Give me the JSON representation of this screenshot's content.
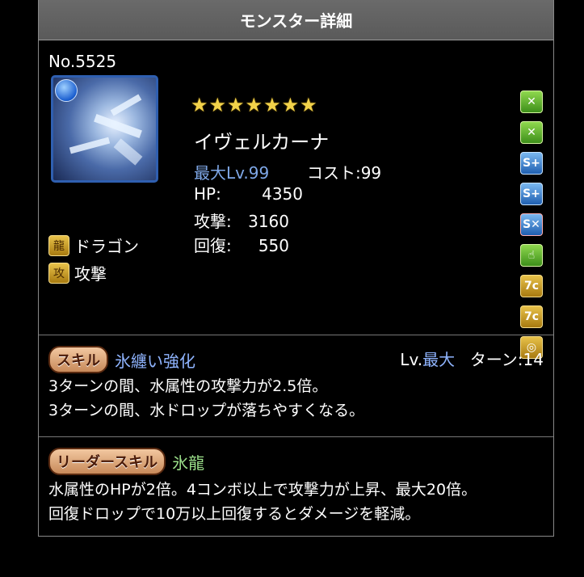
{
  "header": {
    "title": "モンスター詳細"
  },
  "monster": {
    "number": "No.5525",
    "stars": "★★★★★★★",
    "name": "イヴェルカーナ",
    "max_level": "最大Lv.99",
    "cost": "コスト:99",
    "hp_label": "HP:",
    "hp_value": "4350",
    "atk_label": "攻撃:",
    "atk_value": "3160",
    "rcv_label": "回復:",
    "rcv_value": "550",
    "types": [
      "ドラゴン",
      "攻撃"
    ],
    "attribute_icon": "water-orb-icon"
  },
  "awakenings": [
    "bind-resist-icon",
    "bind-resist-icon",
    "skill-boost-icon",
    "skill-boost-icon",
    "skill-delay-resist-icon",
    "enhanced-finger-icon",
    "seven-combo-icon",
    "seven-combo-icon",
    "jammer-resist-icon"
  ],
  "skill": {
    "badge": "スキル",
    "name": "氷纏い強化",
    "lv_prefix": "Lv.",
    "lv_value": "最大",
    "turn": "ターン:14",
    "description": "3ターンの間、水属性の攻撃力が2.5倍。\n3ターンの間、水ドロップが落ちやすくなる。"
  },
  "leader_skill": {
    "badge": "リーダースキル",
    "name": "氷龍",
    "description": "水属性のHPが2倍。4コンボ以上で攻撃力が上昇、最大20倍。\n回復ドロップで10万以上回復するとダメージを軽減。"
  },
  "colors": {
    "accent_blue": "#8fb4ff",
    "leader_green": "#9be08a",
    "star_gold": "#f2d24a"
  }
}
